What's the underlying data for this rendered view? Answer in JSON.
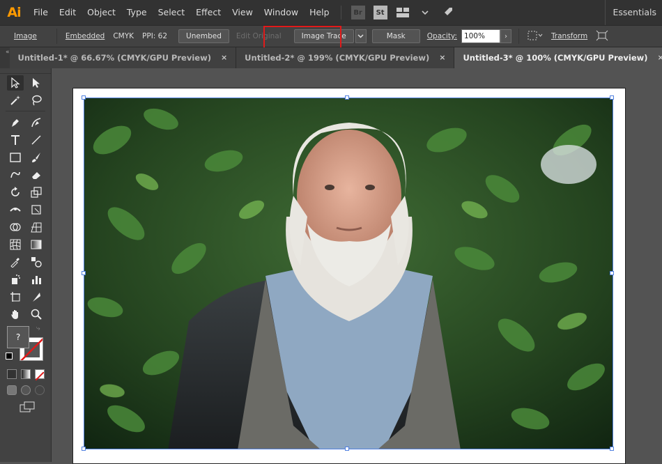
{
  "app": {
    "logo": "Ai",
    "workspace": "Essentials"
  },
  "menu": [
    "File",
    "Edit",
    "Object",
    "Type",
    "Select",
    "Effect",
    "View",
    "Window",
    "Help"
  ],
  "menu_icons": {
    "bridge": "Br",
    "stock": "St"
  },
  "control": {
    "object_type": "Image",
    "embedded": "Embedded",
    "color_mode": "CMYK",
    "ppi": "PPI: 62",
    "unembed": "Unembed",
    "edit_original": "Edit Original",
    "image_trace": "Image Trace",
    "mask": "Mask",
    "opacity_label": "Opacity:",
    "opacity_value": "100%",
    "transform": "Transform"
  },
  "tabs": [
    {
      "label": "Untitled-1* @ 66.67% (CMYK/GPU Preview)",
      "active": false
    },
    {
      "label": "Untitled-2* @ 199% (CMYK/GPU Preview)",
      "active": false
    },
    {
      "label": "Untitled-3* @ 100% (CMYK/GPU Preview)",
      "active": true
    }
  ],
  "icons": {
    "close": "×",
    "chevron": "›",
    "dropdown": "⌄",
    "collapse": "«",
    "fill_question": "?"
  },
  "colors": {
    "accent_orange": "#ff9a00",
    "highlight_red": "#e11a1a",
    "selection_blue": "#4f7fe0",
    "ui_dark": "#323232",
    "ui_mid": "#424242",
    "canvas": "#535353"
  }
}
